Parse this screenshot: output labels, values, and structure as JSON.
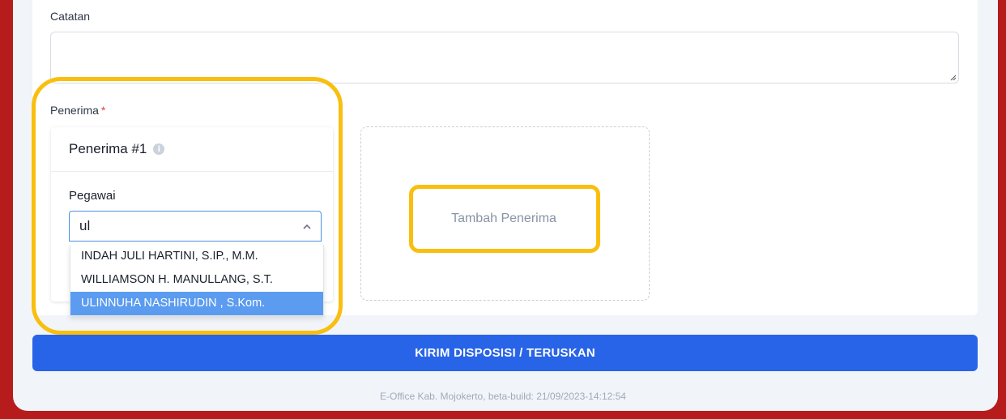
{
  "form": {
    "catatan_label": "Catatan",
    "catatan_value": "",
    "penerima_label": "Penerima",
    "required_mark": "*"
  },
  "recipient": {
    "title": "Penerima #1",
    "info_icon_glyph": "i",
    "pegawai_label": "Pegawai",
    "search_value": "ul",
    "options": [
      "INDAH JULI HARTINI, S.IP., M.M.",
      "WILLIAMSON H. MANULLANG, S.T.",
      "ULINNUHA NASHIRUDIN , S.Kom."
    ],
    "highlighted_option": "ULINNUHA NASHIRUDIN , S.Kom."
  },
  "add_recipient_label": "Tambah Penerima",
  "submit_label": "KIRIM DISPOSISI / TERUSKAN",
  "footer_text": "E-Office Kab. Mojokerto, beta-build: 21/09/2023-14:12:54",
  "colors": {
    "primary": "#2864e8",
    "highlight_option": "#5b9bf0",
    "annotation": "#f9bf10",
    "frame_border": "#b71c1c"
  }
}
